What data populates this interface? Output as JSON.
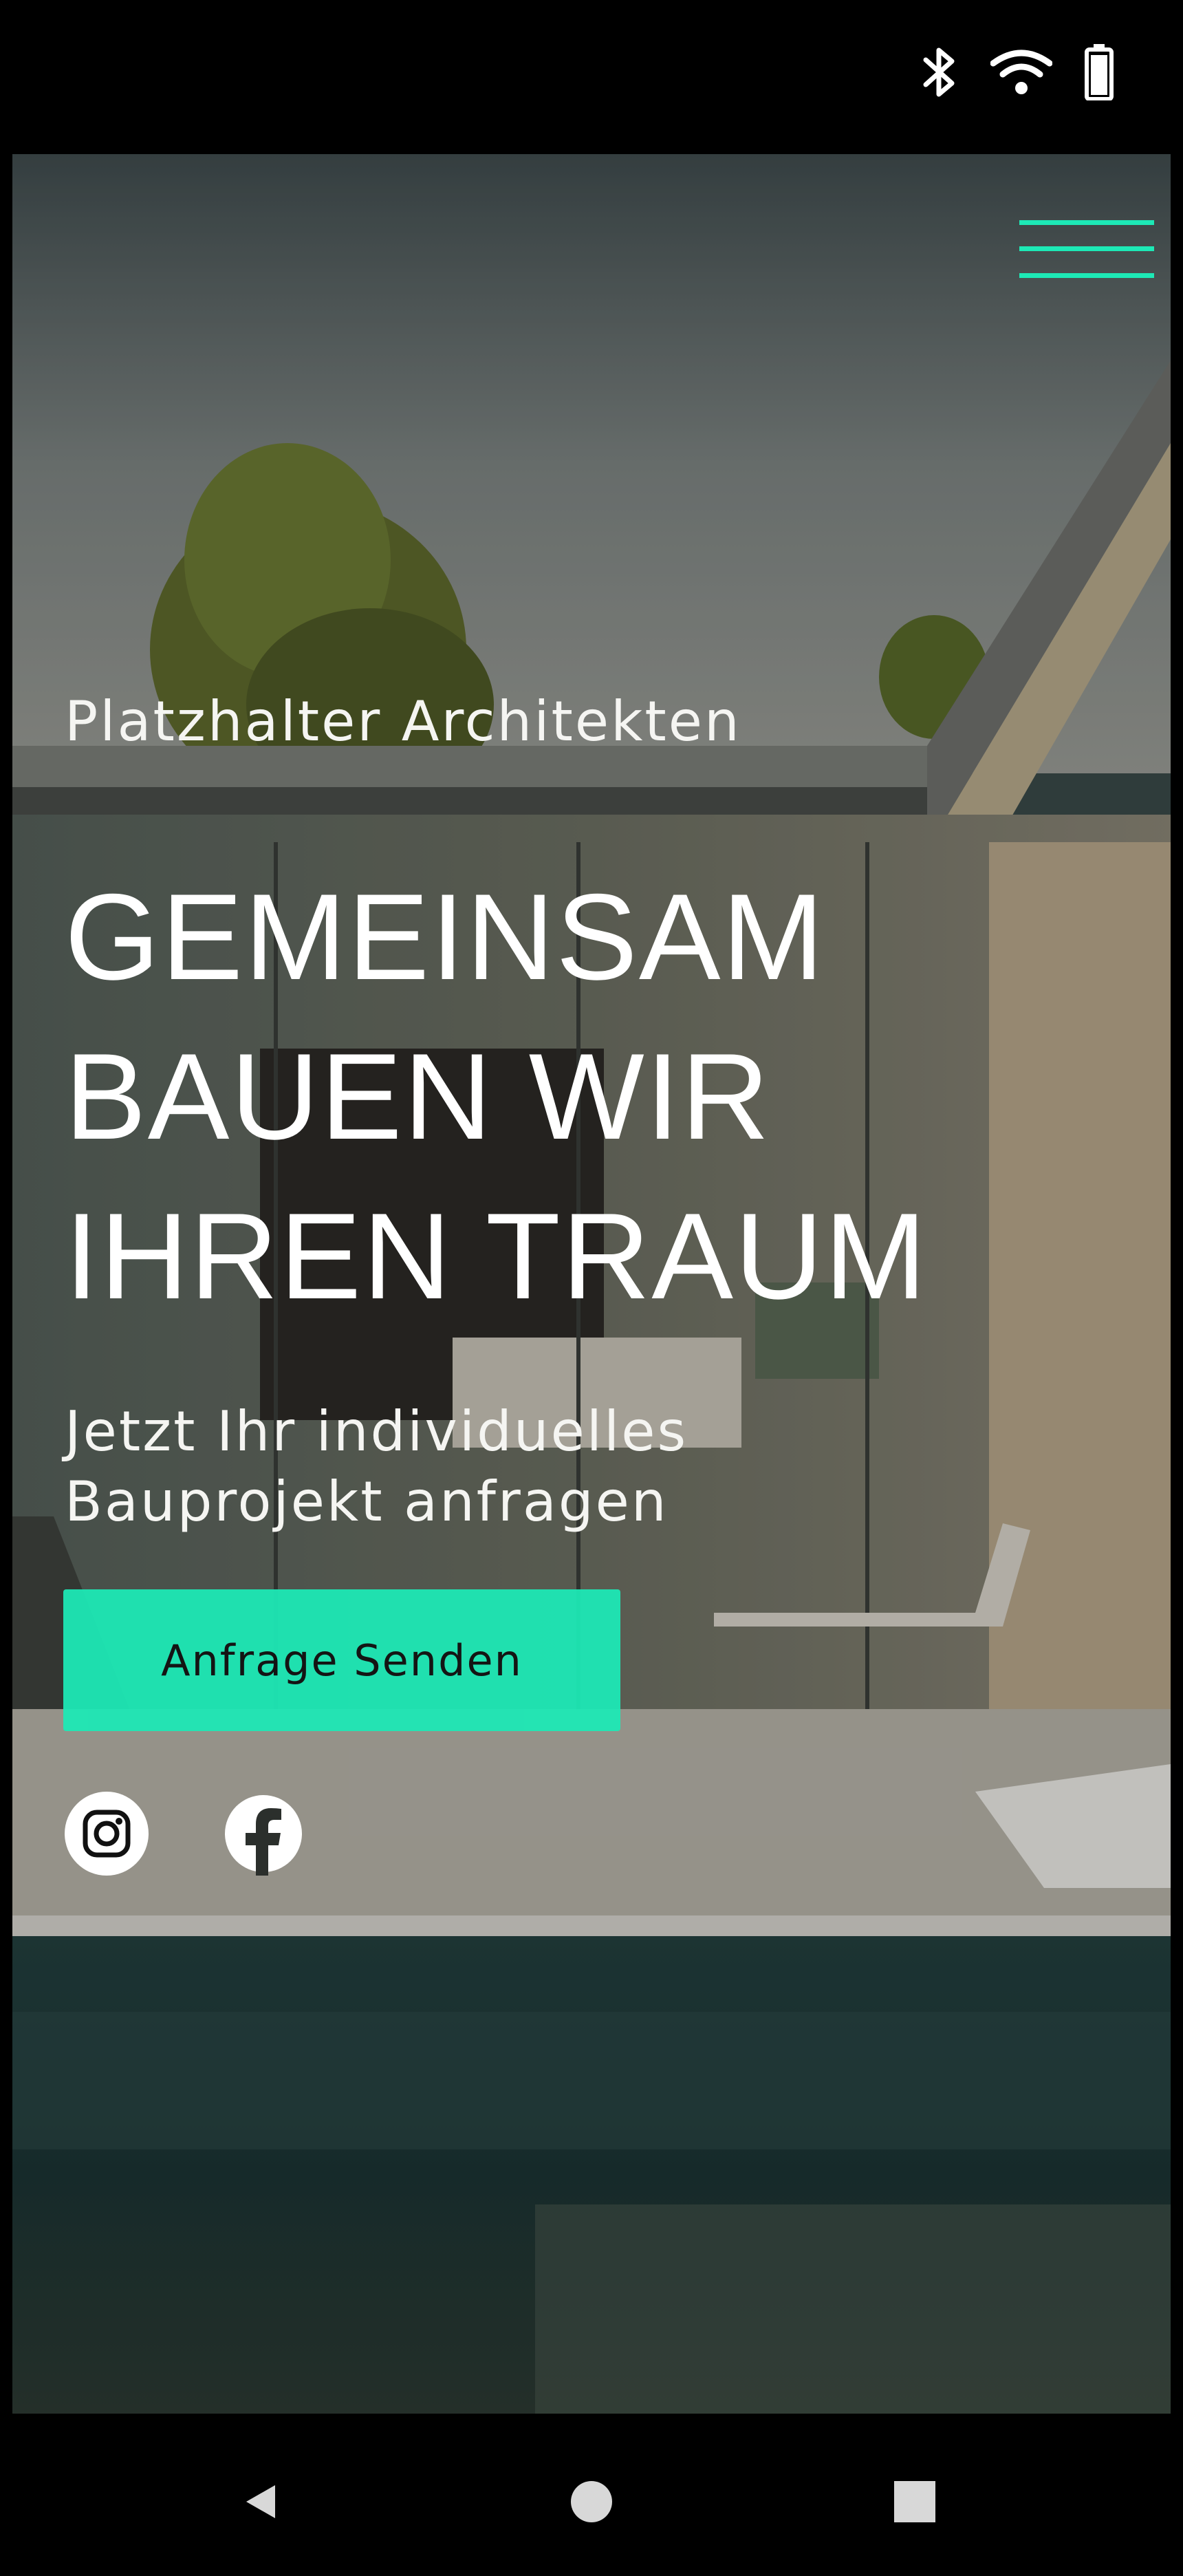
{
  "status_bar": {
    "icons": [
      "bluetooth-icon",
      "wifi-icon",
      "battery-icon"
    ]
  },
  "header": {
    "menu_icon": "hamburger-menu-icon"
  },
  "hero": {
    "brand": "Platzhalter Architekten",
    "headline_lines": [
      "GEMEINSAM",
      "BAUEN WIR",
      "IHREN TRAUM"
    ],
    "subline_lines": [
      "Jetzt Ihr individuelles",
      "Bauprojekt anfragen"
    ],
    "cta_label": "Anfrage Senden",
    "social": [
      "instagram-icon",
      "facebook-icon"
    ]
  },
  "nav_bar": {
    "buttons": [
      "back-icon",
      "home-icon",
      "recents-icon"
    ]
  },
  "colors": {
    "accent": "#1de9b6",
    "text": "#ffffff",
    "system_bar": "#000000"
  }
}
